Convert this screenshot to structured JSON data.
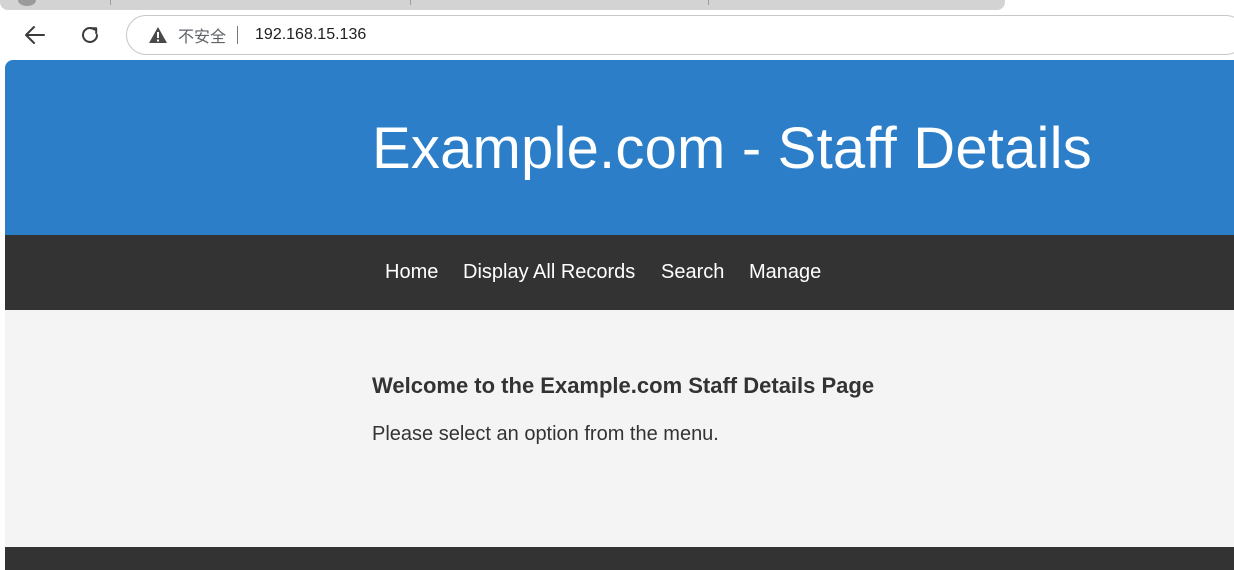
{
  "browser": {
    "security_label": "不安全",
    "url": "192.168.15.136",
    "icons": {
      "back": "back-arrow-icon",
      "reload": "reload-icon",
      "warning": "warning-triangle-icon"
    }
  },
  "site": {
    "title": "Example.com - Staff Details",
    "nav": [
      {
        "label": "Home"
      },
      {
        "label": "Display All Records"
      },
      {
        "label": "Search"
      },
      {
        "label": "Manage"
      }
    ],
    "welcome_heading": "Welcome to the Example.com Staff Details Page",
    "welcome_text": "Please select an option from the menu."
  },
  "colors": {
    "header_bg": "#2b7ec7",
    "nav_bg": "#333333",
    "content_bg": "#f4f4f4",
    "footer_bg": "#333333"
  }
}
